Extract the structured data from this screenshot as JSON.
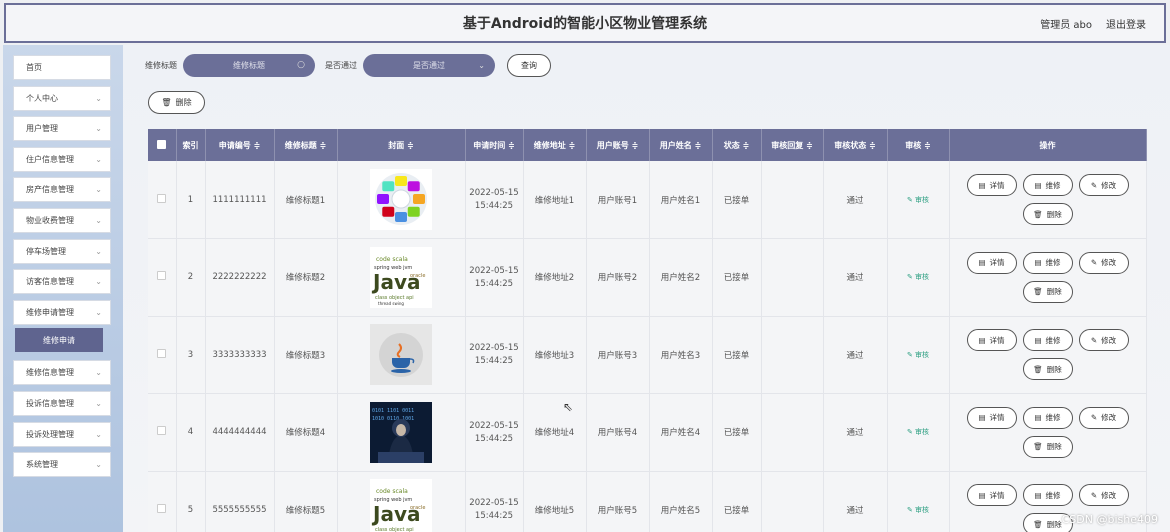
{
  "header": {
    "title": "基于Android的智能小区物业管理系统",
    "user": "管理员 abo",
    "logout": "退出登录"
  },
  "sidebar": {
    "items": [
      {
        "label": "首页",
        "chevron": false
      },
      {
        "label": "个人中心",
        "chevron": true
      },
      {
        "label": "用户管理",
        "chevron": true
      },
      {
        "label": "住户信息管理",
        "chevron": true
      },
      {
        "label": "房产信息管理",
        "chevron": true
      },
      {
        "label": "物业收费管理",
        "chevron": true
      },
      {
        "label": "停车场管理",
        "chevron": true
      },
      {
        "label": "访客信息管理",
        "chevron": true
      },
      {
        "label": "维修申请管理",
        "chevron": true
      },
      {
        "label": "维修信息管理",
        "chevron": true
      },
      {
        "label": "投诉信息管理",
        "chevron": true
      },
      {
        "label": "投诉处理管理",
        "chevron": true
      },
      {
        "label": "系统管理",
        "chevron": true
      }
    ],
    "active_sub": "维修申请"
  },
  "search": {
    "title_label": "维修标题",
    "title_placeholder": "维修标题",
    "passed_label": "是否通过",
    "passed_placeholder": "是否通过",
    "query_button": "查询"
  },
  "toolbar": {
    "delete_label": "删除"
  },
  "table": {
    "headers": {
      "index": "索引",
      "apply_no": "申请编号 ≑",
      "repair_title": "维修标题 ≑",
      "cover": "封面 ≑",
      "apply_time": "申请时间 ≑",
      "repair_addr": "维修地址 ≑",
      "account": "用户账号 ≑",
      "name": "用户姓名 ≑",
      "status": "状态 ≑",
      "reply": "审核回复 ≑",
      "audit_status": "审核状态 ≑",
      "audit": "审核 ≑",
      "ops": "操作"
    },
    "rows": [
      {
        "index": "1",
        "apply_no": "1111111111",
        "repair_title": "维修标题1",
        "date": "2022-05-15",
        "time": "15:44:25",
        "addr": "维修地址1",
        "account": "用户账号1",
        "name": "用户姓名1",
        "status": "已接单",
        "reply": "",
        "audit_status": "通过",
        "audit": "审核",
        "cover": "circle"
      },
      {
        "index": "2",
        "apply_no": "2222222222",
        "repair_title": "维修标题2",
        "date": "2022-05-15",
        "time": "15:44:25",
        "addr": "维修地址2",
        "account": "用户账号2",
        "name": "用户姓名2",
        "status": "已接单",
        "reply": "",
        "audit_status": "通过",
        "audit": "审核",
        "cover": "java"
      },
      {
        "index": "3",
        "apply_no": "3333333333",
        "repair_title": "维修标题3",
        "date": "2022-05-15",
        "time": "15:44:25",
        "addr": "维修地址3",
        "account": "用户账号3",
        "name": "用户姓名3",
        "status": "已接单",
        "reply": "",
        "audit_status": "通过",
        "audit": "审核",
        "cover": "cup"
      },
      {
        "index": "4",
        "apply_no": "4444444444",
        "repair_title": "维修标题4",
        "date": "2022-05-15",
        "time": "15:44:25",
        "addr": "维修地址4",
        "account": "用户账号4",
        "name": "用户姓名4",
        "status": "已接单",
        "reply": "",
        "audit_status": "通过",
        "audit": "审核",
        "cover": "hacker"
      },
      {
        "index": "5",
        "apply_no": "5555555555",
        "repair_title": "维修标题5",
        "date": "2022-05-15",
        "time": "15:44:25",
        "addr": "维修地址5",
        "account": "用户账号5",
        "name": "用户姓名5",
        "status": "已接单",
        "reply": "",
        "audit_status": "通过",
        "audit": "审核",
        "cover": "java"
      }
    ],
    "op_labels": {
      "detail": "详情",
      "repair": "维修",
      "edit": "修改",
      "delete": "删除"
    }
  },
  "cover_text": {
    "java": "Java"
  },
  "watermark": "CSDN @bishe409"
}
